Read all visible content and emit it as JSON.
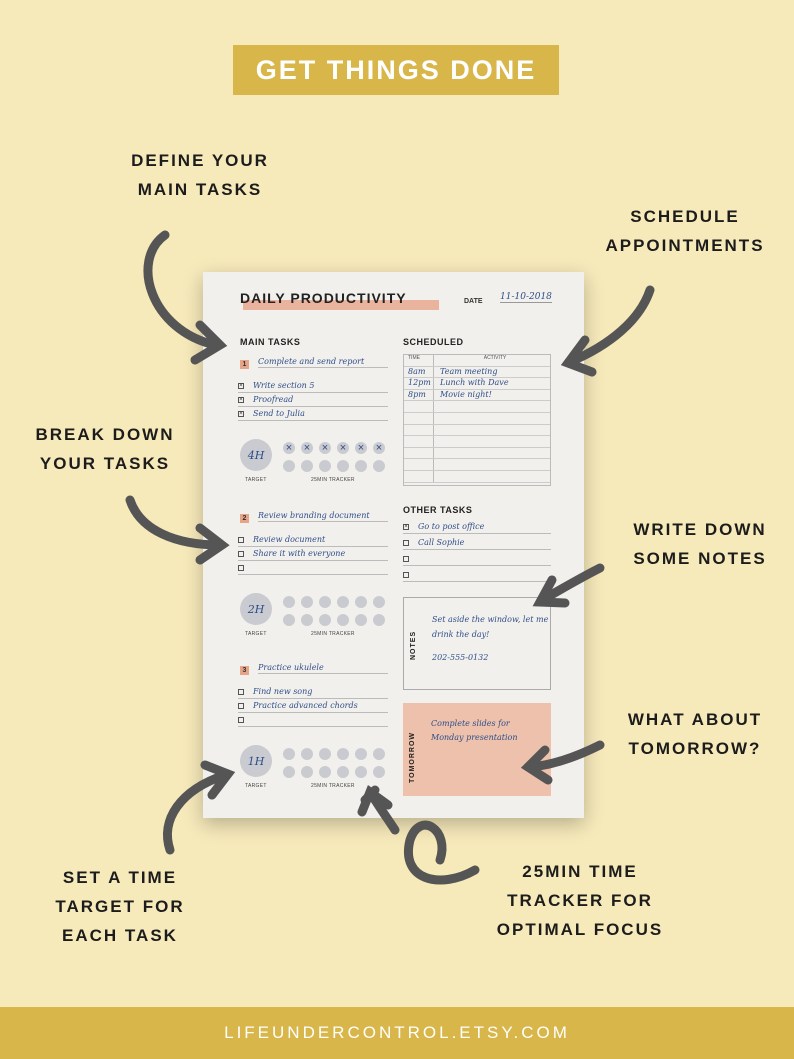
{
  "banner": "GET THINGS DONE",
  "callouts": {
    "main_tasks": [
      "DEFINE YOUR",
      "MAIN TASKS"
    ],
    "schedule": [
      "SCHEDULE",
      "APPOINTMENTS"
    ],
    "breakdown": [
      "BREAK DOWN",
      "YOUR TASKS"
    ],
    "notes": [
      "WRITE DOWN",
      "SOME NOTES"
    ],
    "tomorrow": [
      "WHAT ABOUT",
      "TOMORROW?"
    ],
    "time_target": [
      "SET A TIME",
      "TARGET FOR",
      "EACH TASK"
    ],
    "tracker": [
      "25MIN TIME",
      "TRACKER FOR",
      "OPTIMAL FOCUS"
    ]
  },
  "footer": "LIFEUNDERCONTROL.ETSY.COM",
  "sheet": {
    "title": "DAILY PRODUCTIVITY",
    "date_label": "DATE",
    "date_value": "11-10-2018",
    "main_tasks_label": "MAIN TASKS",
    "scheduled_label": "SCHEDULED",
    "other_tasks_label": "OTHER TASKS",
    "notes_label": "NOTES",
    "tomorrow_label": "TOMORROW",
    "target_label": "TARGET",
    "tracker_label": "25MIN TRACKER",
    "tasks": [
      {
        "num": "1",
        "title": "Complete and send report",
        "subs": [
          {
            "text": "Write section 5",
            "checked": true
          },
          {
            "text": "Proofread",
            "checked": true
          },
          {
            "text": "Send to Julia",
            "checked": true
          }
        ],
        "target": "4H",
        "tracker_done": 6
      },
      {
        "num": "2",
        "title": "Review branding document",
        "subs": [
          {
            "text": "Review document",
            "checked": false
          },
          {
            "text": "Share it with everyone",
            "checked": false
          },
          {
            "text": "",
            "checked": false
          }
        ],
        "target": "2H",
        "tracker_done": 0
      },
      {
        "num": "3",
        "title": "Practice ukulele",
        "subs": [
          {
            "text": "Find new song",
            "checked": false
          },
          {
            "text": "Practice advanced chords",
            "checked": false
          },
          {
            "text": "",
            "checked": false
          }
        ],
        "target": "1H",
        "tracker_done": 0
      }
    ],
    "schedule_headers": {
      "time": "TIME",
      "activity": "ACTIVITY"
    },
    "schedule": [
      {
        "time": "8am",
        "activity": "Team meeting"
      },
      {
        "time": "12pm",
        "activity": "Lunch with Dave"
      },
      {
        "time": "8pm",
        "activity": "Movie night!"
      }
    ],
    "other_tasks": [
      {
        "text": "Go to post office",
        "checked": true
      },
      {
        "text": "Call Sophie",
        "checked": false
      },
      {
        "text": "",
        "checked": false
      },
      {
        "text": "",
        "checked": false
      }
    ],
    "notes": [
      "Set aside the window, let me",
      "drink the day!",
      "202-555-0132"
    ],
    "tomorrow": "Complete slides for Monday presentation"
  }
}
